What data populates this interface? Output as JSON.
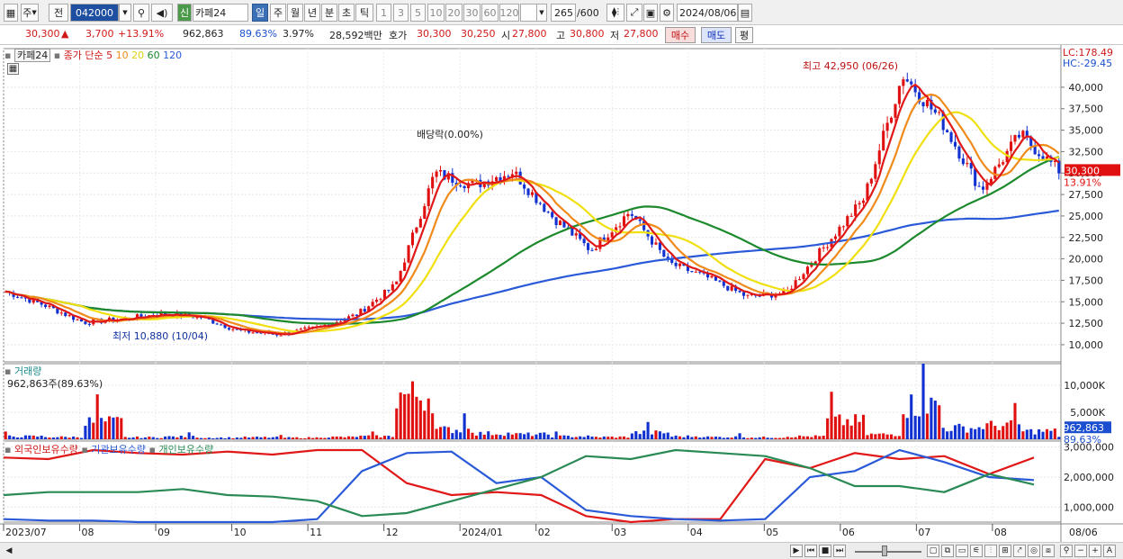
{
  "toolbar": {
    "period_label": "주",
    "prev_label": "전",
    "code": "042000",
    "new_label": "신",
    "name": "카페24",
    "tf_day": "일",
    "tf_week": "주",
    "tf_month": "월",
    "tf_year": "년",
    "tf_min": "분",
    "tf_sec": "초",
    "tf_tick": "틱",
    "intervals": [
      "1",
      "3",
      "5",
      "10",
      "20",
      "30",
      "60",
      "120"
    ],
    "count": "265",
    "count_total": "/600",
    "date": "2024/08/06"
  },
  "quote": {
    "price": "30,300",
    "change": "3,700",
    "change_pct": "+13.91%",
    "volume": "962,863",
    "volume_ratio": "89.63%",
    "turnover": "3.97%",
    "amount": "28,592백만",
    "bid_label": "호가",
    "ask": "30,300",
    "bid": "30,250",
    "open_label": "시",
    "open": "27,800",
    "high_label": "고",
    "high": "30,800",
    "low_label": "저",
    "low": "27,800",
    "buy_label": "매수",
    "sell_label": "매도",
    "eval_label": "평"
  },
  "legend": {
    "stock_name": "카페24",
    "ma_prefix": "종가 단순",
    "ma5": "5",
    "ma10": "10",
    "ma20": "20",
    "ma60": "60",
    "ma120": "120",
    "lc": "LC:178.49",
    "hc": "HC:-29.45",
    "volume_title": "거래량",
    "volume_value": "962,863주(89.63%)",
    "foreign": "외국인보유수량",
    "institution": "기관보유수량",
    "individual": "개인보유수량"
  },
  "annotations": {
    "high": "최고 42,950 (06/26)",
    "low": "최저 10,880 (10/04)",
    "dividend": "배당락(0.00%)"
  },
  "colors": {
    "up": "#e01010",
    "down": "#1030d0",
    "ma5": "#e01818",
    "ma10": "#f08a1a",
    "ma20": "#f0e010",
    "ma60": "#1c8a2c",
    "ma120": "#2a5ad8",
    "foreign": "#e01818",
    "institution": "#2a5ad8",
    "individual": "#2a8a55"
  },
  "chart_data": [
    {
      "type": "candlestick",
      "title": "카페24",
      "x_labels": [
        "2023/07",
        "08",
        "09",
        "10",
        "11",
        "12",
        "2024/01",
        "02",
        "03",
        "04",
        "05",
        "06",
        "07",
        "08",
        "08/06"
      ],
      "y_ticks": [
        "10,000",
        "12,500",
        "15,000",
        "17,500",
        "20,000",
        "22,500",
        "25,000",
        "27,500",
        "30,000",
        "32,500",
        "35,000",
        "37,500",
        "40,000"
      ],
      "ylim": [
        8000,
        44500
      ],
      "current_price": "30,300",
      "current_change": "13.91%",
      "close_series": [
        {
          "label": "2023/07",
          "value": 16200
        },
        {
          "label": "2023/07b",
          "value": 14600
        },
        {
          "label": "08",
          "value": 12600
        },
        {
          "label": "08b",
          "value": 13000
        },
        {
          "label": "09",
          "value": 13600
        },
        {
          "label": "09b",
          "value": 13200
        },
        {
          "label": "10",
          "value": 11600
        },
        {
          "label": "10b",
          "value": 11200
        },
        {
          "label": "11",
          "value": 12000
        },
        {
          "label": "11b",
          "value": 13500
        },
        {
          "label": "12",
          "value": 17000
        },
        {
          "label": "12b",
          "value": 30000
        },
        {
          "label": "2024/01",
          "value": 28600
        },
        {
          "label": "2024/01b",
          "value": 30200
        },
        {
          "label": "02",
          "value": 25000
        },
        {
          "label": "02b",
          "value": 21000
        },
        {
          "label": "03",
          "value": 25500
        },
        {
          "label": "03b",
          "value": 19500
        },
        {
          "label": "04",
          "value": 17800
        },
        {
          "label": "04b",
          "value": 15600
        },
        {
          "label": "05",
          "value": 16000
        },
        {
          "label": "05b",
          "value": 21500
        },
        {
          "label": "06",
          "value": 27000
        },
        {
          "label": "06b",
          "value": 41500
        },
        {
          "label": "07",
          "value": 36000
        },
        {
          "label": "07b",
          "value": 28000
        },
        {
          "label": "08",
          "value": 34500
        },
        {
          "label": "08/06",
          "value": 30300
        }
      ]
    },
    {
      "type": "bar",
      "title": "거래량",
      "y_ticks": [
        "5,000K",
        "10,000K"
      ],
      "current_value": "962,863",
      "current_ratio": "89.63%",
      "values_k": [
        900,
        700,
        5200,
        600,
        800,
        500,
        600,
        500,
        700,
        900,
        13500,
        3000,
        1800,
        1500,
        900,
        700,
        2000,
        900,
        700,
        600,
        900,
        5500,
        1500,
        10500,
        3500,
        4200,
        2500,
        962
      ]
    },
    {
      "type": "line",
      "title": "보유수량",
      "y_ticks": [
        "1,000,000",
        "2,000,000",
        "3,000,000"
      ],
      "series": [
        {
          "name": "외국인보유수량",
          "values": [
            2650000,
            2600000,
            2900000,
            2800000,
            2750000,
            2850000,
            2750000,
            2900000,
            2900000,
            1800000,
            1400000,
            1500000,
            1400000,
            700000,
            500000,
            600000,
            600000,
            2600000,
            2300000,
            2800000,
            2600000,
            2700000,
            2100000,
            2650000
          ]
        },
        {
          "name": "기관보유수량",
          "values": [
            600000,
            550000,
            550000,
            500000,
            500000,
            500000,
            500000,
            600000,
            2200000,
            2800000,
            2850000,
            1800000,
            2000000,
            900000,
            700000,
            600000,
            550000,
            600000,
            2000000,
            2200000,
            2900000,
            2500000,
            2000000,
            1900000
          ]
        },
        {
          "name": "개인보유수량",
          "values": [
            1400000,
            1500000,
            1500000,
            1500000,
            1600000,
            1400000,
            1350000,
            1200000,
            700000,
            800000,
            1200000,
            1600000,
            2000000,
            2700000,
            2600000,
            2900000,
            2800000,
            2700000,
            2300000,
            1700000,
            1700000,
            1500000,
            2100000,
            1750000
          ]
        }
      ]
    }
  ]
}
